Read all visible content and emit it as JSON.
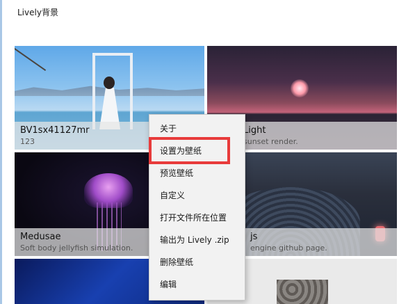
{
  "window": {
    "title": "Lively背景"
  },
  "cards": [
    {
      "title": "BV1sx41127mr",
      "desc": "123"
    },
    {
      "title": "Light",
      "desc": "sunset render."
    },
    {
      "title": "Medusae",
      "desc": "Soft body jellyfish simulation."
    },
    {
      "title": "js",
      "desc": "engine github page."
    }
  ],
  "context_menu": {
    "items": [
      "关于",
      "设置为壁纸",
      "预览壁纸",
      "自定义",
      "打开文件所在位置",
      "输出为 Lively .zip",
      "删除壁纸",
      "编辑"
    ],
    "highlighted": "设置为壁纸"
  },
  "colors": {
    "selection_border": "#1e7bd8",
    "highlight_box": "#e83b3b"
  }
}
